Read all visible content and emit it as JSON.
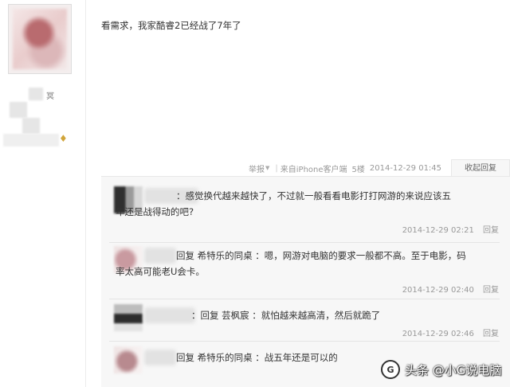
{
  "post": {
    "text": "看需求，我家酷睿2已经战了7年了"
  },
  "meta": {
    "report_label": "举报",
    "source": "来自iPhone客户端",
    "floor": "5楼",
    "timestamp": "2014-12-29 01:45",
    "collapse_label": "收起回复"
  },
  "replies": [
    {
      "line1": "：感觉换代越来越快了，不过就一般看看电影打打网游的来说应该五",
      "line2": "年还是战得动的吧?",
      "time": "2014-12-29 02:21",
      "reply_label": "回复"
    },
    {
      "line1": "回复 希特乐的同桌 ：嗯，网游对电脑的要求一般都不高。至于电影，码",
      "line2": "率太高可能老U会卡。",
      "time": "2014-12-29 02:40",
      "reply_label": "回复"
    },
    {
      "line1": "：回复 芸枫宸 ：就怕越来越高清，然后就跪了",
      "time": "2014-12-29 02:46",
      "reply_label": "回复"
    },
    {
      "line1": "回复 希特乐的同桌 ：战五年还是可以的"
    }
  ],
  "sidebar": {
    "user_glyph": "冥"
  },
  "watermark": {
    "text": "头条 @小G说电脑",
    "logo_glyph": "G"
  }
}
